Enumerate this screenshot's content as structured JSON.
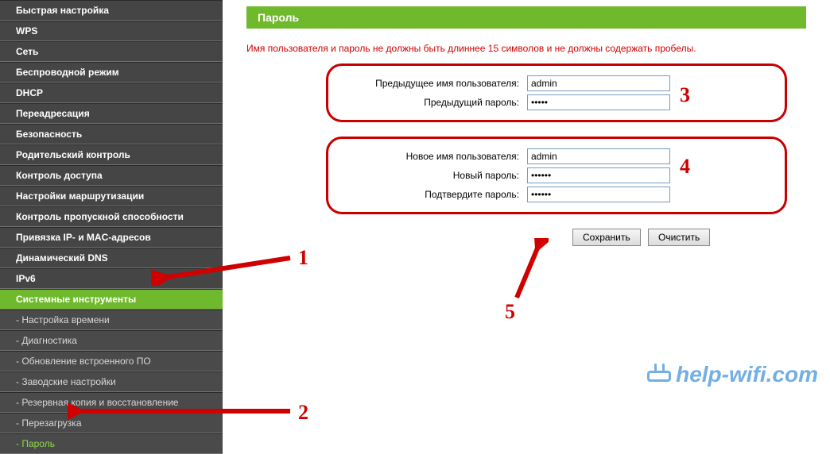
{
  "sidebar": {
    "items": [
      {
        "label": "Быстрая настройка"
      },
      {
        "label": "WPS"
      },
      {
        "label": "Сеть"
      },
      {
        "label": "Беспроводной режим"
      },
      {
        "label": "DHCP"
      },
      {
        "label": "Переадресация"
      },
      {
        "label": "Безопасность"
      },
      {
        "label": "Родительский контроль"
      },
      {
        "label": "Контроль доступа"
      },
      {
        "label": "Настройки маршрутизации"
      },
      {
        "label": "Контроль пропускной способности"
      },
      {
        "label": "Привязка IP- и MAC-адресов"
      },
      {
        "label": "Динамический DNS"
      },
      {
        "label": "IPv6"
      },
      {
        "label": "Системные инструменты"
      }
    ],
    "subitems": [
      {
        "label": "- Настройка времени"
      },
      {
        "label": "- Диагностика"
      },
      {
        "label": "- Обновление встроенного ПО"
      },
      {
        "label": "- Заводские настройки"
      },
      {
        "label": "- Резервная копия и восстановление"
      },
      {
        "label": "- Перезагрузка"
      },
      {
        "label": "- Пароль"
      }
    ]
  },
  "page": {
    "title": "Пароль",
    "warning": "Имя пользователя и пароль не должны быть длиннее 15 символов и не должны содержать пробелы."
  },
  "form": {
    "old_user_label": "Предыдущее имя пользователя:",
    "old_user_value": "admin",
    "old_pass_label": "Предыдущий пароль:",
    "old_pass_value": "•••••",
    "new_user_label": "Новое имя пользователя:",
    "new_user_value": "admin",
    "new_pass_label": "Новый пароль:",
    "new_pass_value": "••••••",
    "confirm_pass_label": "Подтвердите пароль:",
    "confirm_pass_value": "••••••"
  },
  "buttons": {
    "save": "Сохранить",
    "clear": "Очистить"
  },
  "annotations": {
    "n1": "1",
    "n2": "2",
    "n3": "3",
    "n4": "4",
    "n5": "5"
  },
  "watermark": "help-wifi.com"
}
